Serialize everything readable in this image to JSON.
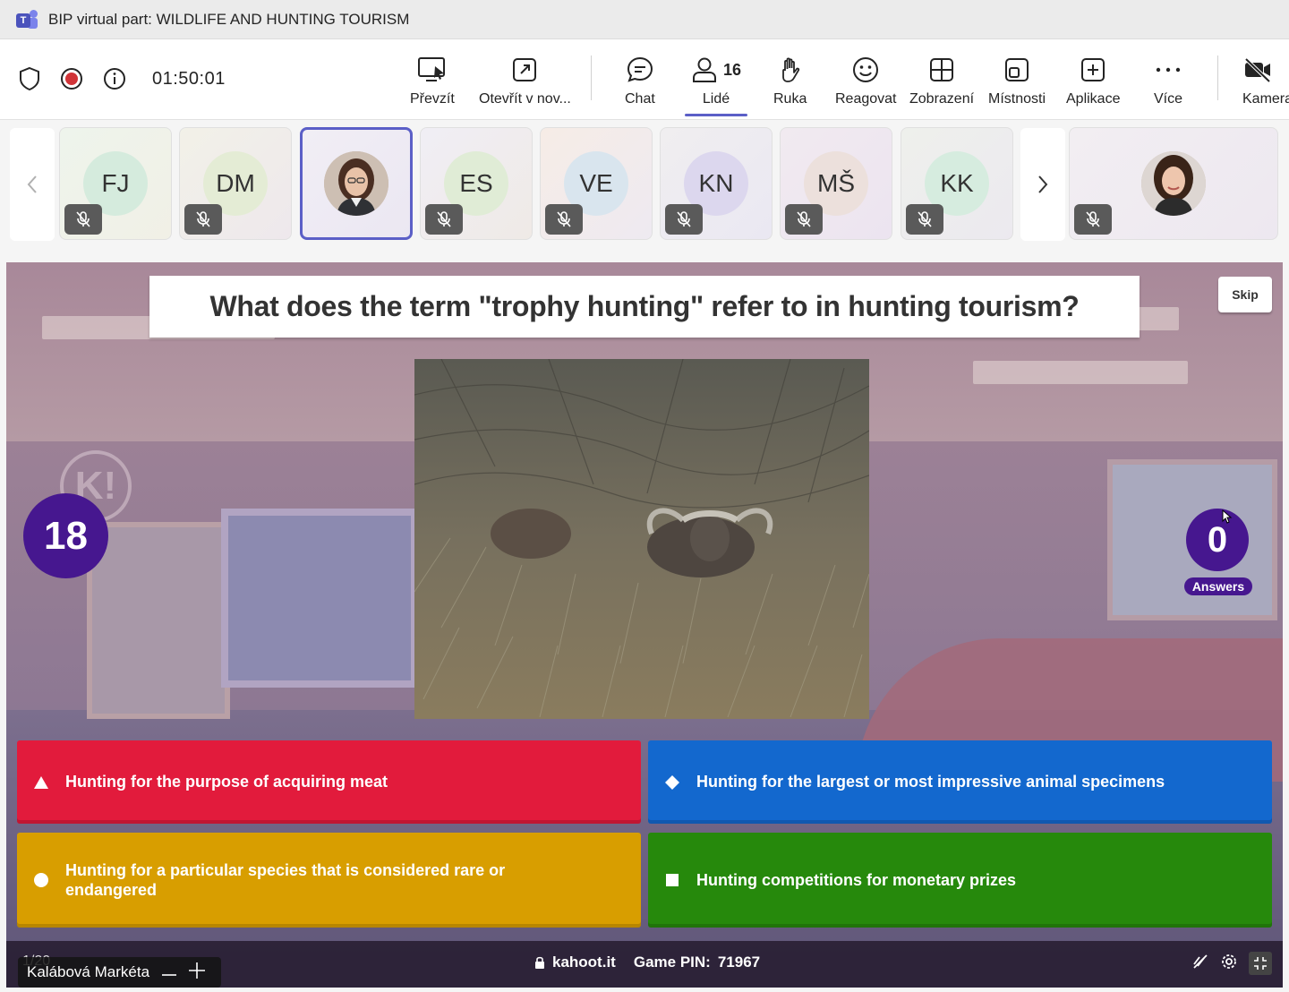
{
  "window": {
    "title": "BIP virtual part: WILDLIFE AND HUNTING TOURISM"
  },
  "toolbar": {
    "timer": "01:50:01",
    "buttons": {
      "prevzit": "Převzít",
      "otevrit": "Otevřít v nov...",
      "chat": "Chat",
      "lide": "Lidé",
      "lide_count": "16",
      "ruka": "Ruka",
      "reagovat": "Reagovat",
      "zobrazeni": "Zobrazení",
      "mistnosti": "Místnosti",
      "aplikace": "Aplikace",
      "vice": "Více",
      "kamera": "Kamera"
    }
  },
  "participants": [
    {
      "initials": "FJ",
      "color": "#d5ebdd"
    },
    {
      "initials": "DM",
      "color": "#e4ecd5"
    },
    {
      "initials": "",
      "color": "#c9b7a7"
    },
    {
      "initials": "ES",
      "color": "#e0ecd6"
    },
    {
      "initials": "VE",
      "color": "#d9e5ee"
    },
    {
      "initials": "KN",
      "color": "#dcd7ee"
    },
    {
      "initials": "MŠ",
      "color": "#ece0dc"
    },
    {
      "initials": "KK",
      "color": "#d6ecdf"
    }
  ],
  "kahoot": {
    "question": "What does the term \"trophy hunting\" refer to in hunting tourism?",
    "skip": "Skip",
    "timer": "18",
    "answers_count": "0",
    "answers_label": "Answers",
    "options": [
      {
        "shape": "triangle",
        "text": "Hunting for the purpose of acquiring meat",
        "color": "#e21b3c"
      },
      {
        "shape": "diamond",
        "text": "Hunting for the largest or most impressive animal specimens",
        "color": "#1368ce"
      },
      {
        "shape": "circle",
        "text": "Hunting for a particular species that is considered rare or endangered",
        "color": "#d89e00"
      },
      {
        "shape": "square",
        "text": "Hunting competitions for monetary prizes",
        "color": "#26890c"
      }
    ],
    "counter": "1/20",
    "site": "kahoot.it",
    "pin_label": "Game PIN:",
    "pin": "71967",
    "presenter": "Kalábová Markéta"
  }
}
